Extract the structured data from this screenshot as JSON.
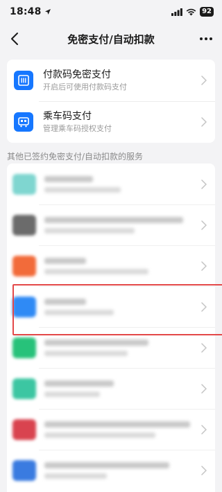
{
  "status_bar": {
    "time": "18:48",
    "battery": "92"
  },
  "nav": {
    "title": "免密支付/自动扣款",
    "back_icon": "chevron-left-icon",
    "more_icon": "more-dots-icon"
  },
  "services": [
    {
      "title": "付款码免密支付",
      "subtitle": "开启后可使用付款码支付",
      "icon": "payment-code-icon",
      "color": "#1677ff"
    },
    {
      "title": "乘车码支付",
      "subtitle": "管理乘车码授权支付",
      "icon": "transit-code-icon",
      "color": "#1677ff"
    }
  ],
  "section_header": "其他已签约免密支付/自动扣款的服务",
  "highlighted_row_index": 3,
  "list_items": [
    {
      "icon_color": "#7fd6d0",
      "has_chevron": true
    },
    {
      "icon_color": "#6b6b6b",
      "has_chevron": true
    },
    {
      "icon_color": "#f26b3a",
      "has_chevron": true
    },
    {
      "icon_color": "#2f8af5",
      "has_chevron": true
    },
    {
      "icon_color": "#27c27a",
      "has_chevron": true
    },
    {
      "icon_color": "#3cc6a2",
      "has_chevron": true
    },
    {
      "icon_color": "#d9434f",
      "has_chevron": true
    },
    {
      "icon_color": "#3a7be0",
      "has_chevron": true
    }
  ]
}
